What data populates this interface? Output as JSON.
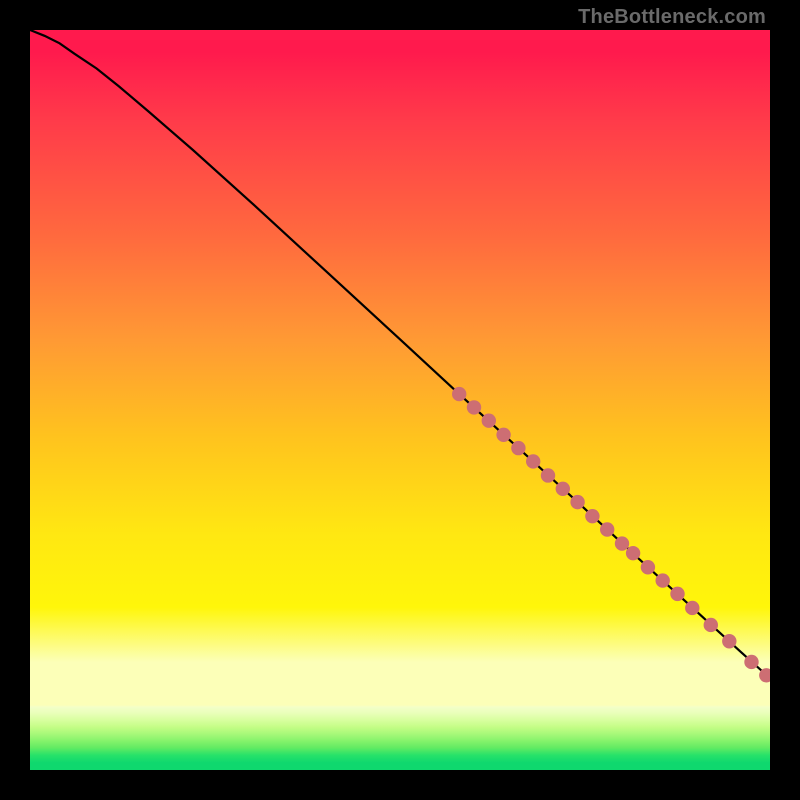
{
  "watermark": "TheBottleneck.com",
  "colors": {
    "background": "#000000",
    "curve": "#000000",
    "marker_fill": "#cd6e73",
    "marker_stroke": "#a94c54"
  },
  "chart_data": {
    "type": "line",
    "title": "",
    "xlabel": "",
    "ylabel": "",
    "xlim": [
      0,
      100
    ],
    "ylim": [
      0,
      100
    ],
    "grid": false,
    "legend": false,
    "series": [
      {
        "name": "curve",
        "kind": "line",
        "x": [
          0,
          2,
          4,
          6,
          9,
          12,
          16,
          22,
          30,
          40,
          50,
          58,
          66,
          74,
          82,
          90,
          96,
          100
        ],
        "y": [
          100,
          99.2,
          98.2,
          96.8,
          94.8,
          92.4,
          89.0,
          83.8,
          76.6,
          67.4,
          58.2,
          50.8,
          43.5,
          36.2,
          28.8,
          21.5,
          16.0,
          12.4
        ]
      },
      {
        "name": "markers",
        "kind": "scatter",
        "x": [
          58.0,
          60.0,
          62.0,
          64.0,
          66.0,
          68.0,
          70.0,
          72.0,
          74.0,
          76.0,
          78.0,
          80.0,
          81.5,
          83.5,
          85.5,
          87.5,
          89.5,
          92.0,
          94.5,
          97.5,
          99.5
        ],
        "y": [
          50.8,
          49.0,
          47.2,
          45.3,
          43.5,
          41.7,
          39.8,
          38.0,
          36.2,
          34.3,
          32.5,
          30.6,
          29.3,
          27.4,
          25.6,
          23.8,
          21.9,
          19.6,
          17.4,
          14.6,
          12.8
        ]
      }
    ]
  }
}
